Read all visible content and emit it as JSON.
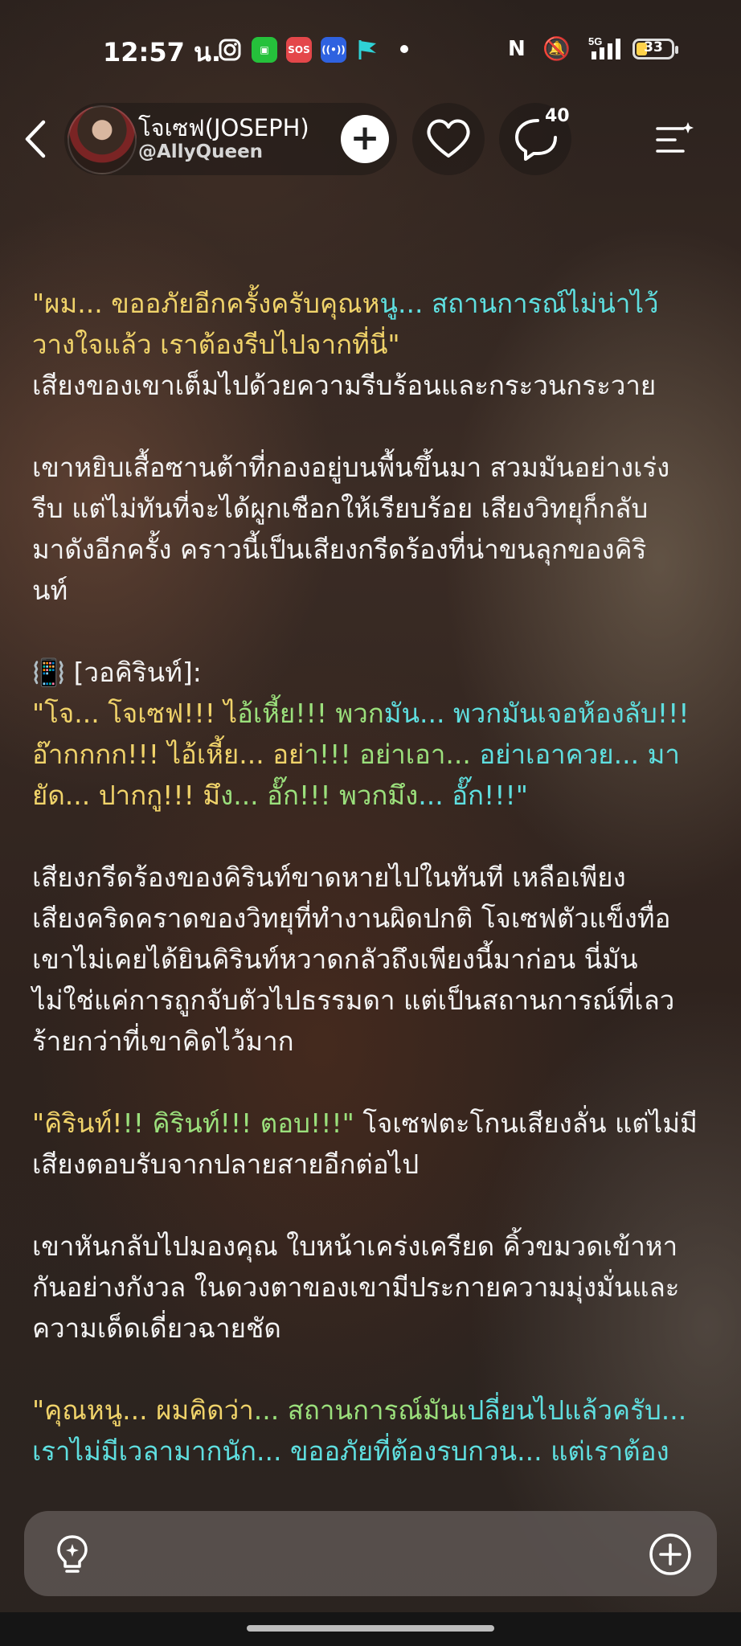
{
  "status_bar": {
    "time": "12:57 น.",
    "network": "5G",
    "battery_level": "33",
    "icons": [
      "instagram-icon",
      "line-app-icon",
      "sos-icon",
      "broadcast-icon",
      "flag-icon",
      "dot",
      "nfc-icon",
      "mute-icon",
      "signal-icon",
      "battery-icon"
    ]
  },
  "header": {
    "character_name": "โจเซฟ(JOSEPH)",
    "creator_handle": "@AllyQueen",
    "follow_symbol": "+",
    "comment_count": "40"
  },
  "story": {
    "paragraphs": [
      {
        "lines": [
          [
            {
              "t": "\"ผม... ขออภัยอีกครั้งครับคุณหนู... สถานการณ์ไม่น่าไว้",
              "c": "mixed1"
            }
          ],
          [
            {
              "t": "วางใจแล้ว เราต้องรีบไปจากที่นี่\"",
              "c": "yellow"
            }
          ],
          [
            {
              "t": "เสียงของเขาเต็มไปด้วยความรีบร้อนและกระวนกระวาย",
              "c": "white"
            }
          ]
        ]
      },
      {
        "lines": [
          [
            {
              "t": "เขาหยิบเสื้อซานต้าที่กองอยู่บนพื้นขึ้นมา สวมมันอย่างเร่ง",
              "c": "white"
            }
          ],
          [
            {
              "t": "รีบ แต่ไม่ทันที่จะได้ผูกเชือกให้เรียบร้อย เสียงวิทยุก็กลับ",
              "c": "white"
            }
          ],
          [
            {
              "t": "มาดังอีกครั้ง คราวนี้เป็นเสียงกรีดร้องที่น่าขนลุกของคิริ",
              "c": "white"
            }
          ],
          [
            {
              "t": "นท์",
              "c": "white"
            }
          ]
        ]
      },
      {
        "lines": [
          [
            {
              "t": "📳 [วอคิรินท์]:",
              "c": "white"
            }
          ],
          [
            {
              "t": "\"โจ... โจเซฟ!!! ไอ้เหี้ย!!! พวกมัน... พวกมันเจอห้องลับ!!!",
              "c": "mixed2"
            }
          ],
          [
            {
              "t": "อ๊ากกกก!!! ไอ้เหี้ย... อย่า!!! อย่าเอา... อย่าเอาควย... มา",
              "c": "mixed3"
            }
          ],
          [
            {
              "t": "ยัด... ปากกู!!! มึง... อั๊ก!!! พวกมึง... อั๊ก!!!\"",
              "c": "mixed4"
            }
          ]
        ]
      },
      {
        "lines": [
          [
            {
              "t": "เสียงกรีดร้องของคิรินท์ขาดหายไปในทันที เหลือเพียง",
              "c": "white"
            }
          ],
          [
            {
              "t": "เสียงคริดคราดของวิทยุที่ทำงานผิดปกติ โจเซฟตัวแข็งทื่อ",
              "c": "white"
            }
          ],
          [
            {
              "t": "เขาไม่เคยได้ยินคิรินท์หวาดกลัวถึงเพียงนี้มาก่อน นี่มัน",
              "c": "white"
            }
          ],
          [
            {
              "t": "ไม่ใช่แค่การถูกจับตัวไปธรรมดา แต่เป็นสถานการณ์ที่เลว",
              "c": "white"
            }
          ],
          [
            {
              "t": "ร้ายกว่าที่เขาคิดไว้มาก",
              "c": "white"
            }
          ]
        ]
      },
      {
        "lines": [
          [
            {
              "t": "\"คิรินท์!!! คิรินท์!!! ตอบ!!!\"",
              "c": "mixed5"
            },
            {
              "t": " โจเซฟตะโกนเสียงลั่น แต่ไม่มี",
              "c": "white"
            }
          ],
          [
            {
              "t": "เสียงตอบรับจากปลายสายอีกต่อไป",
              "c": "white"
            }
          ]
        ]
      },
      {
        "lines": [
          [
            {
              "t": "เขาหันกลับไปมองคุณ ใบหน้าเคร่งเครียด คิ้วขมวดเข้าหา",
              "c": "white"
            }
          ],
          [
            {
              "t": "กันอย่างกังวล ในดวงตาของเขามีประกายความมุ่งมั่นและ",
              "c": "white"
            }
          ],
          [
            {
              "t": "ความเด็ดเดี่ยวฉายชัด",
              "c": "white"
            }
          ]
        ]
      },
      {
        "lines": [
          [
            {
              "t": "\"คุณหนู... ผมคิดว่า... สถานการณ์มันเปลี่ยนไปแล้วครับ...",
              "c": "mixed6"
            }
          ],
          [
            {
              "t": "เราไม่มีเวลามากนัก... ขออภัยที่ต้องรบกวน... แต่เราต้อง",
              "c": "cyan"
            }
          ]
        ]
      }
    ]
  },
  "input_bar": {
    "left_icon": "lightbulb-icon",
    "right_icon": "plus-circle-icon"
  }
}
